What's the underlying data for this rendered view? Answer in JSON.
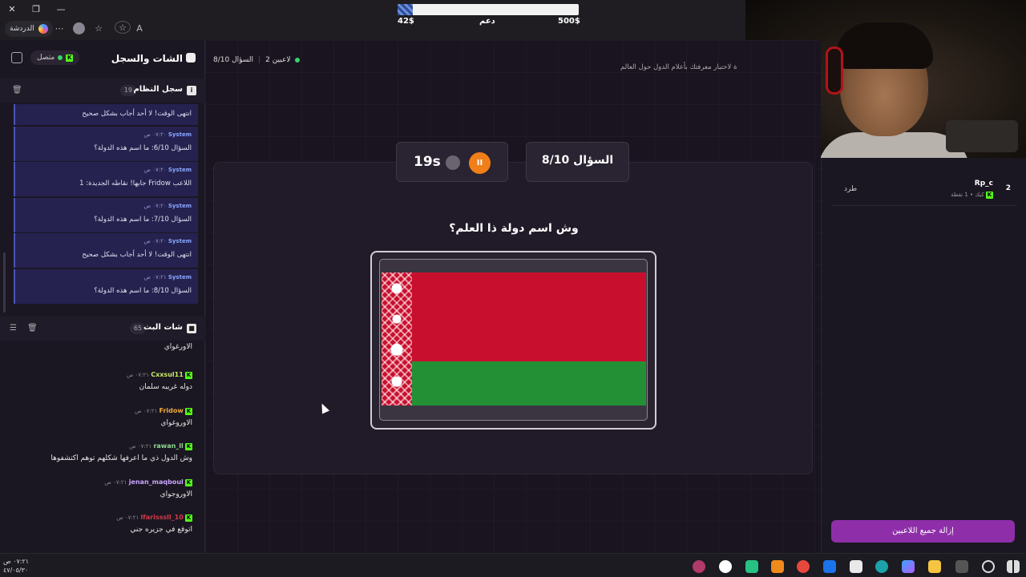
{
  "browser": {
    "chat_label": "الدردشة",
    "window_buttons": [
      "✕",
      "❐",
      "—"
    ],
    "toolbar_icons": [
      "more-icon",
      "profile-icon",
      "favorites-icon",
      "star-icon",
      "read-aloud-icon"
    ]
  },
  "donation": {
    "current": "42$",
    "label": "دعم",
    "goal": "500$",
    "progress": 0.084
  },
  "sidebar": {
    "title": "الشات والسجل",
    "status": "متصل",
    "system_log": {
      "title": "سجل النظام",
      "count": "19",
      "messages": [
        {
          "sender": "",
          "time": "",
          "text": "انتهى الوقت! لا أحد أجاب بشكل صحيح"
        },
        {
          "sender": "System",
          "time": "٠٧:٢٠ ص",
          "text": "السؤال 6/10: ما اسم هذه الدولة؟"
        },
        {
          "sender": "System",
          "time": "٠٧:٢٠ ص",
          "text": "اللاعب Fridow جابها! نقاطه الجديدة: 1"
        },
        {
          "sender": "System",
          "time": "٠٧:٢٠ ص",
          "text": "السؤال 7/10: ما اسم هذه الدولة؟"
        },
        {
          "sender": "System",
          "time": "٠٧:٢٠ ص",
          "text": "انتهى الوقت! لا أحد أجاب بشكل صحيح"
        },
        {
          "sender": "System",
          "time": "٠٧:٢١ ص",
          "text": "السؤال 8/10: ما اسم هذه الدولة؟"
        }
      ]
    },
    "stream_chat": {
      "title": "شات البث",
      "count": "65",
      "messages": [
        {
          "user": "",
          "time": "",
          "text": "الاورغواي",
          "color": "#ffffff"
        },
        {
          "user": "Cxxsul11",
          "time": "٠٧:٢١ ص",
          "text": "دوله غريبه سلمان",
          "color": "#c7e86a"
        },
        {
          "user": "Fridow",
          "time": "٠٧:٢١ ص",
          "text": "الاوروغواي",
          "color": "#f0a93a"
        },
        {
          "user": "rawan_ll",
          "time": "٠٧:٢١ ص",
          "text": "وش الدول ذي ما اعرفها شكلهم توهم اكتشفوها",
          "color": "#8fd98f"
        },
        {
          "user": "jenan_maqboul",
          "time": "٠٧:٢١ ص",
          "text": "الاوروجواي",
          "color": "#c9a3ff"
        },
        {
          "user": "lfarisssll_10",
          "time": "٠٧:٢١ ص",
          "text": "اتوقع في جزيره جني",
          "color": "#d23a4a"
        }
      ]
    }
  },
  "game": {
    "players_count": "2 لاعبين",
    "question_status": "السؤال 8/10",
    "subtitle": "ة لاختبار معرفتك بأعلام الدول حول العالم",
    "timer": "19s",
    "question_label": "السؤال 8/10",
    "question_text": "وش اسم دولة ذا العلم؟",
    "flag_colors": {
      "red": "#c8102e",
      "green": "#249035",
      "white": "#ffffff"
    }
  },
  "players_panel": {
    "players": [
      {
        "rank": "2",
        "name": "Rp_c",
        "points": "كيك • 1 نقطة",
        "kick_label": "طرد"
      }
    ],
    "remove_all_label": "إزالة جميع اللاعبين"
  },
  "taskbar": {
    "time": "٠٧:٢١ ص",
    "date": "٤٧/٠٥/٣٠",
    "icons": [
      "chrome-icon",
      "obs-icon",
      "app-icon",
      "vlc-icon",
      "chrome-alt-icon",
      "outlook-icon",
      "store-icon",
      "edge-icon",
      "copilot-icon",
      "explorer-icon",
      "snipping-icon",
      "search-icon",
      "start-icon"
    ]
  }
}
